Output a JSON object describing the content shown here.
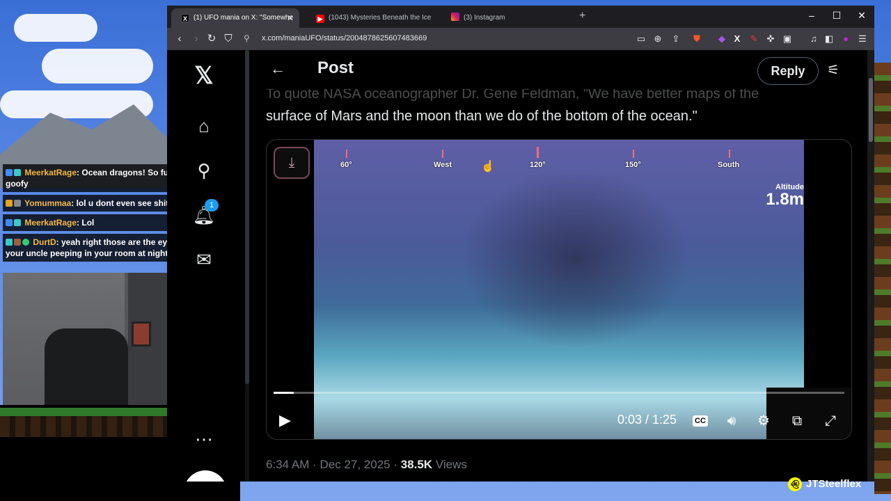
{
  "browser": {
    "tabs": [
      {
        "label": "(1) UFO mania on X: \"Somewhe",
        "favicon": "x-logo-icon",
        "active": true
      },
      {
        "label": "(1043) Mysteries Beneath the Ice",
        "favicon": "youtube-icon",
        "active": false
      },
      {
        "label": "(3) Instagram",
        "favicon": "instagram-icon",
        "active": false
      }
    ],
    "url": "x.com/maniaUFO/status/2004878625607483669"
  },
  "chat": [
    {
      "user": "MeerkatRage",
      "message": ": Ocean dragons! So fucking goofy"
    },
    {
      "user": "Yomummaa",
      "message": ": lol u dont even see shit"
    },
    {
      "user": "MeerkatRage",
      "message": ": Lol"
    },
    {
      "user": "DurtD",
      "message": ": yeah right those are the eyes of your uncle peeping in your room at night"
    }
  ],
  "x": {
    "notification_count": "1",
    "header_title": "Post",
    "reply_label": "Reply",
    "post_text_partial": "To quote NASA oceanographer Dr. Gene Feldman, \"We have better maps of the",
    "post_text": "surface of Mars and the moon than we do of the bottom of the ocean.\"",
    "video": {
      "compass": [
        "60°",
        "West",
        "120°",
        "150°",
        "South"
      ],
      "altitude_label": "Altitude",
      "altitude_value": "1.8m",
      "time": "0:03 / 1:25",
      "progress": 0.035,
      "cc_label": "CC"
    },
    "meta": {
      "time": "6:34 AM · Dec 27, 2025 · ",
      "views_count": "38.5K",
      "views_label": " Views"
    }
  },
  "streamer_tag": "JTSteelflex",
  "colors": {
    "accent": "#1d9bf0",
    "chat_name": "#f5b942"
  }
}
